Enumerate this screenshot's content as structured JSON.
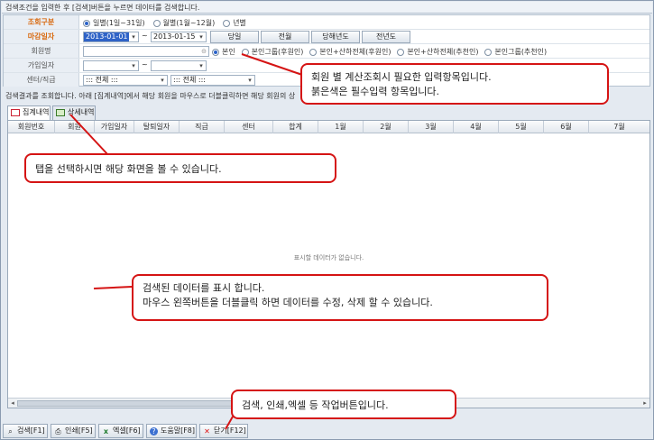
{
  "hint_top": "검색조건을 입력한 후 [검색]버튼을 누르면 데이터를 검색합니다.",
  "form": {
    "search_type_label": "조회구분",
    "search_type_options": [
      "일별(1일~31일)",
      "월별(1월~12월)",
      "년별"
    ],
    "deadline_label": "마감일자",
    "date_from": "2013-01-01",
    "date_to": "2013-01-15",
    "tilde": "~",
    "date_buttons": [
      "당일",
      "전월",
      "당해년도",
      "전년도"
    ],
    "member_label": "회원명",
    "member_scope_options": [
      "본인",
      "본인그룹(후원인)",
      "본인+산하전체(후원인)",
      "본인+산하전체(추천인)",
      "본인그룹(추천인)"
    ],
    "join_date_label": "가입일자",
    "center_label": "센터/직급",
    "center_value": "::: 전체 :::",
    "rank_value": "::: 전체 :::"
  },
  "result_hint": "검색결과를 조회합니다. 아래 [집계내역]에서 해당 회원을 마우스로 더블클릭하면 해당 회원의 상",
  "tabs": [
    "집계내역",
    "상세내역"
  ],
  "grid_columns": [
    "회원번호",
    "회원",
    "가입일자",
    "탈퇴일자",
    "직급",
    "센터",
    "합계",
    "1월",
    "2월",
    "3월",
    "4월",
    "5월",
    "6월",
    "7월"
  ],
  "grid_empty": "표시할 데이터가 없습니다.",
  "toolbar": {
    "search": "검색[F1]",
    "print": "인쇄[F5]",
    "excel": "엑셀[F6]",
    "help": "도움말[F8]",
    "close": "닫기[F12]"
  },
  "callouts": {
    "input": [
      "회원 별 계산조회시 필요한 입력항목입니다.",
      "붉은색은 필수입력 항목입니다."
    ],
    "tab": [
      "탭을 선택하시면 해당 화면을 볼 수 있습니다."
    ],
    "data": [
      "검색된 데이터를 표시 합니다.",
      "마우스 왼쪽버튼을 더블클릭 하면 데이터를 수정, 삭제 할 수 있습니다."
    ],
    "buttons": [
      "검색, 인쇄,엑셀 등 작업버튼입니다."
    ]
  },
  "colors": {
    "callout_border": "#d51414",
    "required_label": "#d96b12",
    "selected_input": "#2f63c7"
  }
}
